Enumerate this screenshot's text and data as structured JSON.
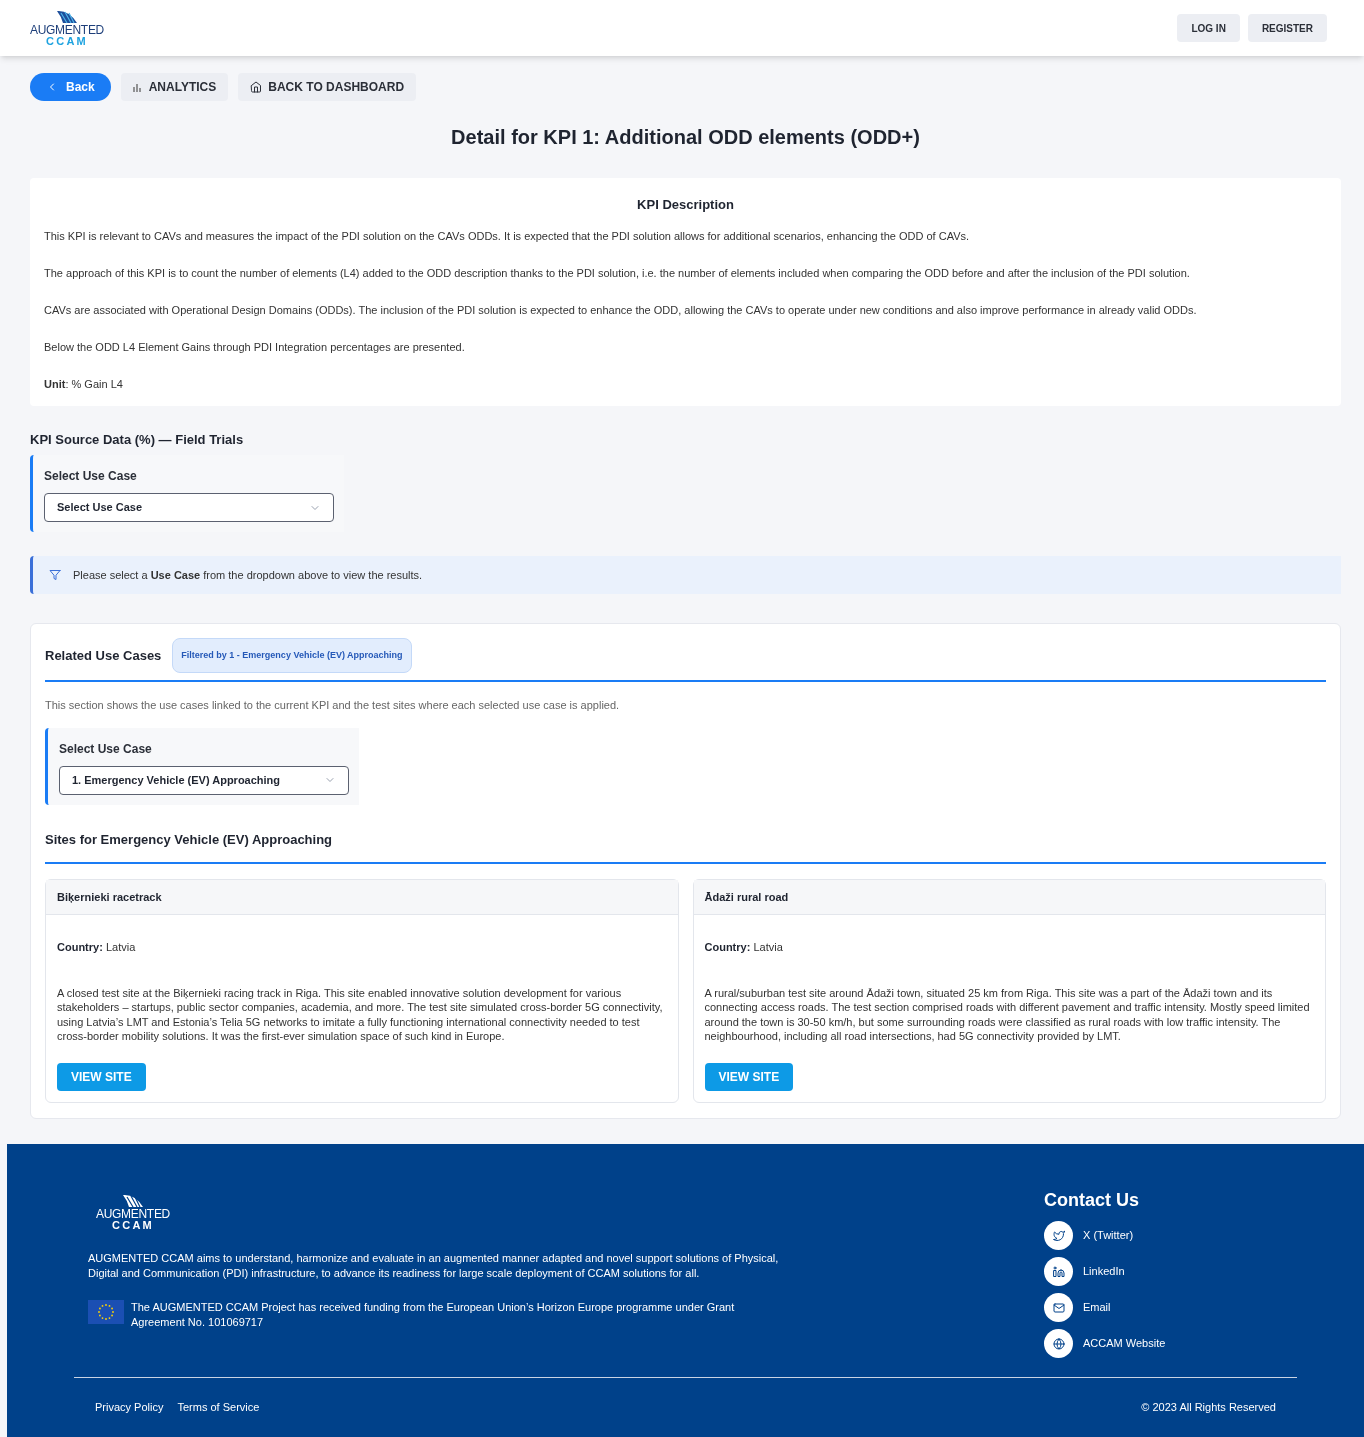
{
  "header": {
    "logo": {
      "line1": "AUGMENTED",
      "line2": "CCAM"
    },
    "buttons": [
      "LOG IN",
      "REGISTER"
    ]
  },
  "nav": [
    {
      "kind": "back",
      "label": "Back"
    },
    {
      "kind": "analytics",
      "label": "ANALYTICS"
    },
    {
      "kind": "dashboard",
      "label": "BACK TO DASHBOARD"
    }
  ],
  "title": "Detail for KPI 1: Additional ODD elements (ODD+)",
  "description": {
    "heading": "KPI Description",
    "paragraphs": [
      "This KPI is relevant to CAVs and measures the impact of the PDI solution on the CAVs ODDs. It is expected that the PDI solution allows for additional scenarios, enhancing the ODD of CAVs.",
      "The approach of this KPI is to count the number of elements (L4) added to the ODD description thanks to the PDI solution, i.e. the number of elements included when comparing the ODD before and after the inclusion of the PDI solution.",
      "CAVs are associated with Operational Design Domains (ODDs). The inclusion of the PDI solution is expected to enhance the ODD, allowing the CAVs to operate under new conditions and also improve performance in already valid ODDs.",
      "Below the ODD L4 Element Gains through PDI Integration percentages are presented.",
      "**Unit**: % Gain L4"
    ]
  },
  "source": {
    "heading": "KPI Source Data (%) — Field Trials",
    "select_label": "Select Use Case",
    "select_value": "Select Use Case",
    "notice": "Please select a **Use Case** from the dropdown above to view the results."
  },
  "related": {
    "heading": "Related Use Cases",
    "filter_badge": "Filtered by 1 - Emergency Vehicle (EV) Approaching",
    "intro": "This section shows the use cases linked to the current KPI and the test sites where each selected use case is applied.",
    "select_label": "Select Use Case",
    "select_value": "1. Emergency Vehicle (EV) Approaching",
    "sites_heading": "Sites for Emergency Vehicle (EV) Approaching",
    "sites": [
      {
        "name": "Biķernieki racetrack",
        "country_label": "Country:",
        "country": "Latvia",
        "text": "A closed test site at the Biķernieki racing track in Riga. This site enabled innovative solution development for various stakeholders – startups, public sector companies, academia, and more. The test site simulated cross-border 5G connectivity, using Latvia’s LMT and Estonia’s Telia 5G networks to imitate a fully functioning international connectivity needed to test cross-border mobility solutions. It was the first-ever simulation space of such kind in Europe.",
        "button": "VIEW SITE"
      },
      {
        "name": "Ādaži rural road",
        "country_label": "Country:",
        "country": "Latvia",
        "text": "A rural/suburban test site around Ādaži town, situated 25 km from Riga. This site was a part of the Ādaži town and its connecting access roads. The test section comprised roads with different pavement and traffic intensity. Mostly speed limited around the town is 30-50 km/h, but some surrounding roads were classified as rural roads with low traffic intensity. The neighbourhood, including all road intersections, had 5G connectivity provided by LMT.",
        "button": "VIEW SITE"
      }
    ]
  },
  "footer": {
    "logo": {
      "line1": "AUGMENTED",
      "line2": "CCAM"
    },
    "about": "AUGMENTED CCAM aims to understand, harmonize and evaluate in an augmented manner adapted and novel support solutions of Physical, Digital and Communication (PDI) infrastructure, to advance its readiness for large scale deployment of CCAM solutions for all.",
    "funding": "The AUGMENTED CCAM Project has received funding from the European Union’s Horizon Europe programme under Grant Agreement No. 101069717",
    "contact_heading": "Contact Us",
    "contacts": [
      {
        "kind": "twitter",
        "label": "X (Twitter)"
      },
      {
        "kind": "linkedin",
        "label": "LinkedIn"
      },
      {
        "kind": "email",
        "label": "Email"
      },
      {
        "kind": "website",
        "label": "ACCAM Website"
      }
    ],
    "links": [
      "Privacy Policy",
      "Terms of Service"
    ],
    "copyright": "© 2023 All Rights Reserved"
  }
}
